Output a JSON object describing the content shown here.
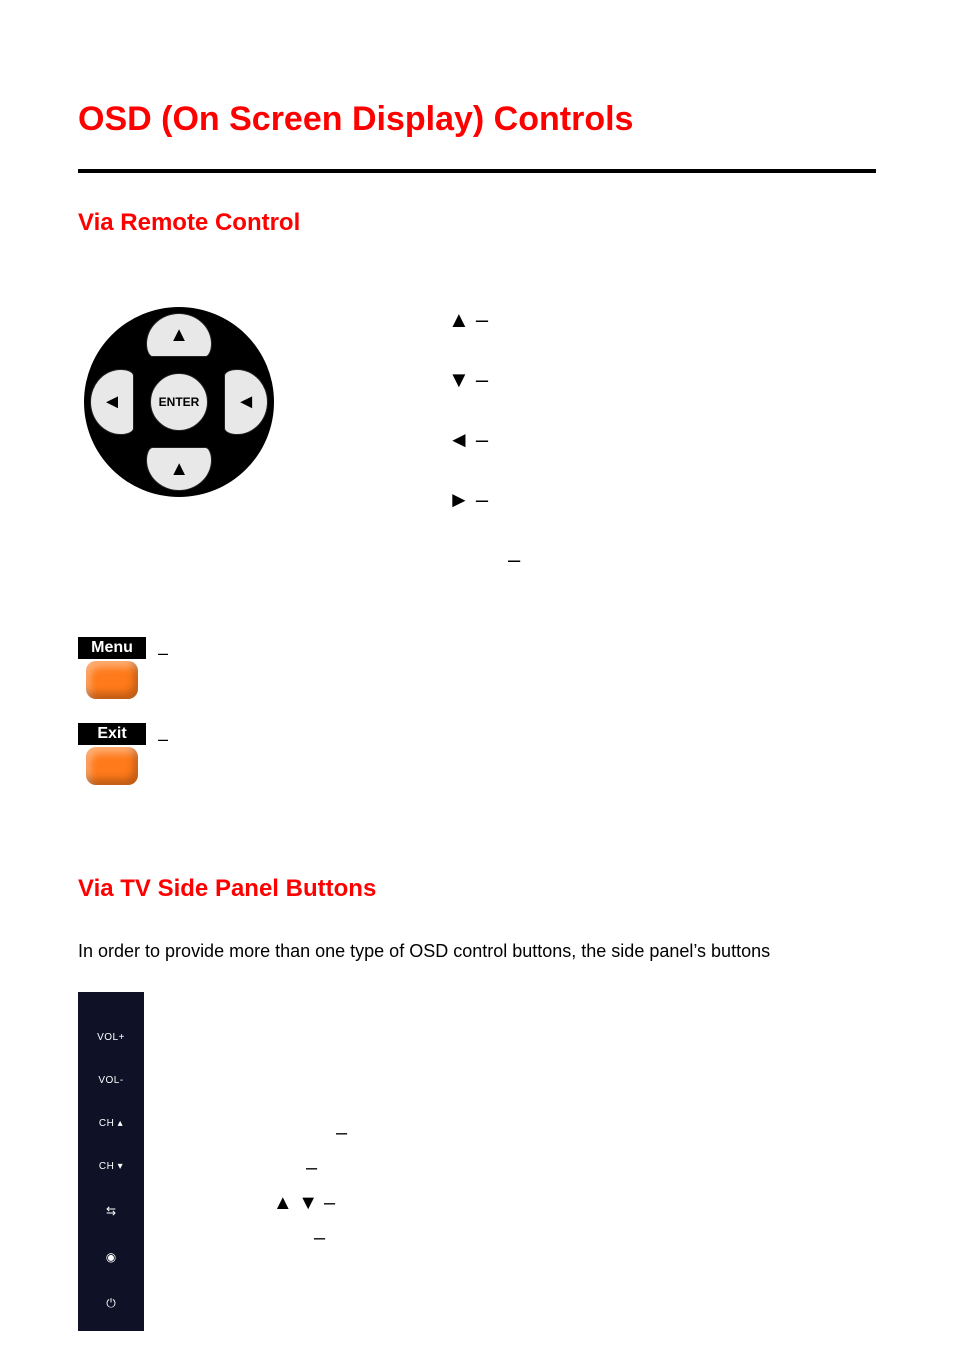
{
  "title": "OSD (On Screen Display) Controls",
  "section_remote": "Via Remote Control",
  "dpad": {
    "enter": "ENTER"
  },
  "legend": {
    "up": {
      "sym": "▲",
      "dash": "–"
    },
    "down": {
      "sym": "▼",
      "dash": "–"
    },
    "left": {
      "sym": "◄",
      "dash": "–"
    },
    "right": {
      "sym": "►",
      "dash": "–"
    },
    "extra_dash": "–"
  },
  "menu": {
    "label": "Menu",
    "dash": "–"
  },
  "exit": {
    "label": "Exit",
    "dash": "–"
  },
  "section_panel": "Via TV Side Panel Buttons",
  "panel_intro": "In order to provide more than one type of OSD control buttons, the side panel’s buttons",
  "side_panel": {
    "vol_up": "VOL+",
    "vol_down": "VOL-",
    "ch_up": "CH ▴",
    "ch_down": "CH ▾",
    "input_icon": "⇆",
    "menu_icon": "◉",
    "power_icon": "⏻"
  },
  "panel_legend": {
    "r1": {
      "lead": "",
      "dash": "–"
    },
    "r2": {
      "lead": "",
      "dash": "–"
    },
    "r3": {
      "lead": "▲ ▼",
      "dash": "–"
    },
    "r4": {
      "lead": "",
      "dash": "–"
    }
  }
}
